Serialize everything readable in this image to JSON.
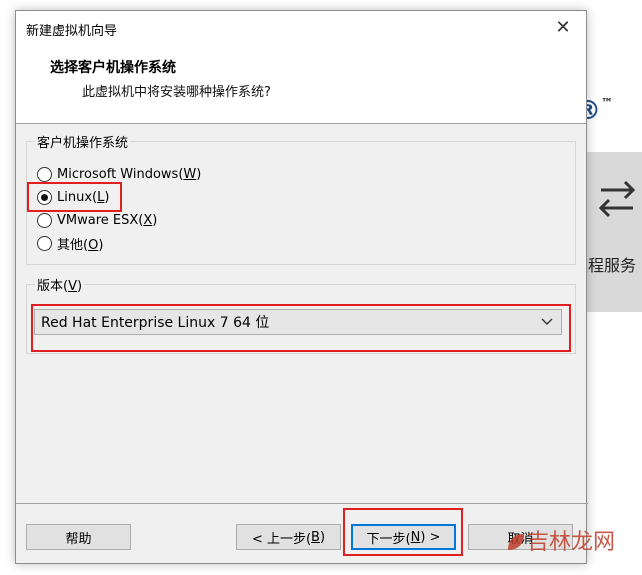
{
  "background_app": {
    "brand_suffix": "®",
    "trademark": "™",
    "remote_label": "远程服务"
  },
  "dialog": {
    "title": "新建虚拟机向导",
    "close_glyph": "✕",
    "header": {
      "title": "选择客户机操作系统",
      "subtitle": "此虚拟机中将安装哪种操作系统?"
    },
    "os_group": {
      "label": "客户机操作系统",
      "options": [
        {
          "label_pre": "Microsoft Windows(",
          "accel": "W",
          "label_post": ")",
          "checked": false
        },
        {
          "label_pre": "Linux(",
          "accel": "L",
          "label_post": ")",
          "checked": true
        },
        {
          "label_pre": "VMware ESX(",
          "accel": "X",
          "label_post": ")",
          "checked": false
        },
        {
          "label_pre": "其他(",
          "accel": "O",
          "label_post": ")",
          "checked": false
        }
      ]
    },
    "version_group": {
      "label_pre": "版本(",
      "accel": "V",
      "label_post": ")",
      "selected": "Red Hat Enterprise Linux 7 64 位"
    },
    "buttons": {
      "help": "帮助",
      "back_pre": "< 上一步(",
      "back_accel": "B",
      "back_post": ")",
      "next_pre": "下一步(",
      "next_accel": "N",
      "next_post": ") >",
      "cancel": "取消"
    }
  },
  "watermark": "吉林龙网",
  "colors": {
    "highlight": "#e02020",
    "focus": "#0078d7"
  }
}
